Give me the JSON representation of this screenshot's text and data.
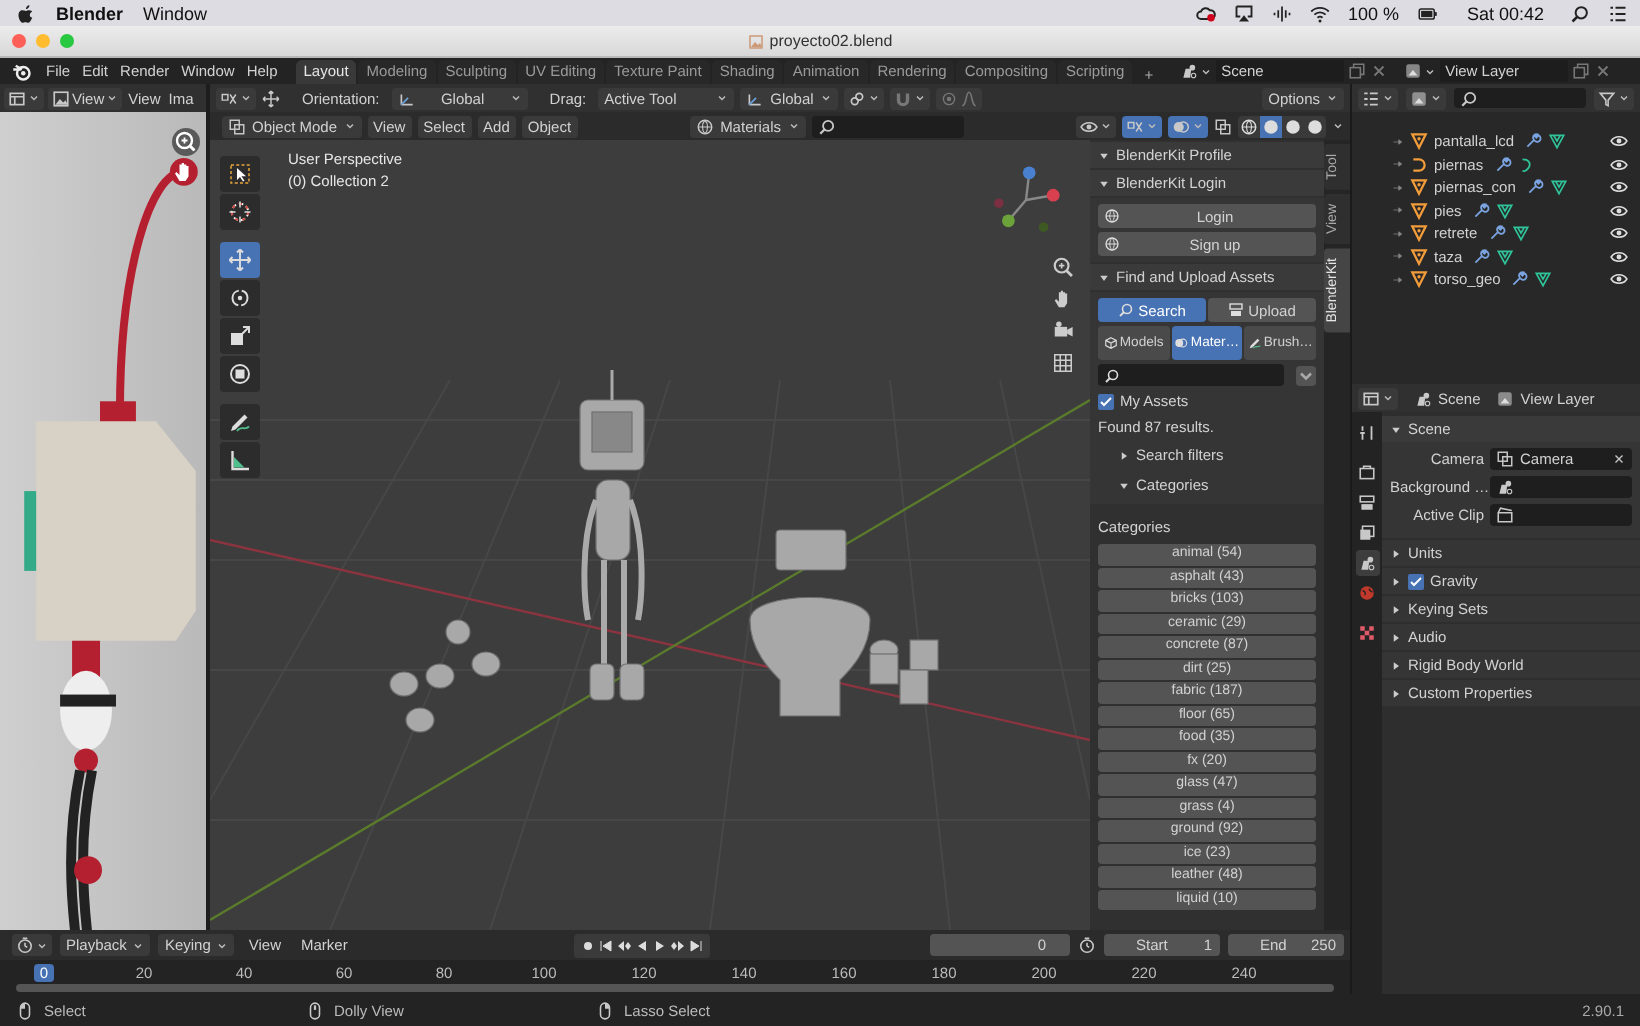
{
  "mac_menubar": {
    "app": "Blender",
    "menus": [
      "Window"
    ],
    "battery": "100 %",
    "clock": "Sat 00:42"
  },
  "window": {
    "title": "proyecto02.blend"
  },
  "topbar": {
    "menus": [
      "File",
      "Edit",
      "Render",
      "Window",
      "Help"
    ],
    "workspaces": [
      {
        "label": "Layout",
        "selected": true
      },
      {
        "label": "Modeling",
        "selected": false
      },
      {
        "label": "Sculpting",
        "selected": false
      },
      {
        "label": "UV Editing",
        "selected": false
      },
      {
        "label": "Texture Paint",
        "selected": false
      },
      {
        "label": "Shading",
        "selected": false
      },
      {
        "label": "Animation",
        "selected": false
      },
      {
        "label": "Rendering",
        "selected": false
      },
      {
        "label": "Compositing",
        "selected": false
      },
      {
        "label": "Scripting",
        "selected": false
      }
    ],
    "add_workspace": "+",
    "scene": "Scene",
    "view_layer": "View Layer"
  },
  "image_editor": {
    "view_dropdown": "View",
    "menus": [
      "View",
      "Ima"
    ]
  },
  "tool_header": {
    "orientation_label": "Orientation:",
    "orientation": "Global",
    "drag_label": "Drag:",
    "drag": "Active Tool",
    "pivot_orientation": "Global",
    "options": "Options"
  },
  "viewport_header": {
    "mode": "Object Mode",
    "menus": [
      "View",
      "Select",
      "Add",
      "Object"
    ],
    "filter": "Materials",
    "shading": [
      {
        "selected": false
      },
      {
        "selected": true
      },
      {
        "selected": false
      },
      {
        "selected": false
      }
    ]
  },
  "viewport": {
    "perspective": "User Perspective",
    "collection": "(0) Collection 2",
    "tools": [
      {
        "kind": "select",
        "selected": false
      },
      {
        "kind": "cursor",
        "selected": false
      },
      {
        "kind": "move",
        "selected": true
      },
      {
        "kind": "rotate",
        "selected": false
      },
      {
        "kind": "scale",
        "selected": false
      },
      {
        "kind": "transform",
        "selected": false
      },
      {
        "kind": "annotate",
        "selected": false
      },
      {
        "kind": "measure",
        "selected": false
      }
    ]
  },
  "sidebar": {
    "tabs": [
      {
        "label": "Tool",
        "selected": false
      },
      {
        "label": "View",
        "selected": false
      },
      {
        "label": "BlenderKit",
        "selected": true
      }
    ],
    "profile_panel": {
      "title": "BlenderKit Profile",
      "expanded": true
    },
    "login_panel": {
      "title": "BlenderKit Login",
      "expanded": true,
      "buttons": [
        "Login",
        "Sign up"
      ]
    },
    "assets_panel": {
      "title": "Find and Upload Assets",
      "expanded": true,
      "modes": [
        {
          "label": "Search",
          "selected": true
        },
        {
          "label": "Upload",
          "selected": false
        }
      ],
      "asset_types": [
        {
          "label": "Models",
          "selected": false
        },
        {
          "label": "Mater…",
          "selected": true
        },
        {
          "label": "Brush…",
          "selected": false
        }
      ],
      "my_assets": {
        "label": "My Assets",
        "checked": true
      },
      "results": "Found 87 results.",
      "subpanels": [
        {
          "title": "Search filters",
          "expanded": false
        },
        {
          "title": "Categories",
          "expanded": true
        }
      ],
      "categories_label": "Categories",
      "categories": [
        "animal (54)",
        "asphalt (43)",
        "bricks (103)",
        "ceramic (29)",
        "concrete (87)",
        "dirt (25)",
        "fabric (187)",
        "floor (65)",
        "food (35)",
        "fx (20)",
        "glass (47)",
        "grass (4)",
        "ground (92)",
        "ice (23)",
        "leather (48)",
        "liquid (10)"
      ]
    }
  },
  "outliner": {
    "rows": [
      {
        "name": "pantalla_lcd",
        "kind": "mesh"
      },
      {
        "name": "piernas",
        "kind": "curve"
      },
      {
        "name": "piernas_con",
        "kind": "mesh"
      },
      {
        "name": "pies",
        "kind": "mesh"
      },
      {
        "name": "retrete",
        "kind": "mesh"
      },
      {
        "name": "taza",
        "kind": "mesh"
      },
      {
        "name": "torso_geo",
        "kind": "mesh"
      }
    ]
  },
  "properties": {
    "context": "Scene",
    "view_layer": "View Layer",
    "tabs": [
      {
        "kind": "tool",
        "selected": false
      },
      {
        "kind": "render",
        "selected": false
      },
      {
        "kind": "output",
        "selected": false
      },
      {
        "kind": "view_layer",
        "selected": false
      },
      {
        "kind": "scene",
        "selected": true
      },
      {
        "kind": "world",
        "selected": false
      },
      {
        "kind": "texture",
        "selected": false
      }
    ],
    "panel": {
      "title": "Scene",
      "expanded": true,
      "fields": [
        {
          "label": "Camera",
          "value": "Camera"
        },
        {
          "label": "Background …"
        },
        {
          "label": "Active Clip"
        }
      ]
    },
    "subpanels": [
      {
        "title": "Units",
        "expanded": false
      },
      {
        "title": "Gravity",
        "expanded": false,
        "checked": true
      },
      {
        "title": "Keying Sets",
        "expanded": false
      },
      {
        "title": "Audio",
        "expanded": false
      },
      {
        "title": "Rigid Body World",
        "expanded": false
      },
      {
        "title": "Custom Properties",
        "expanded": false
      }
    ]
  },
  "timeline": {
    "menus": [
      {
        "label": "Playback",
        "dropdown": true
      },
      {
        "label": "Keying",
        "dropdown": true
      },
      {
        "label": "View",
        "dropdown": false
      },
      {
        "label": "Marker",
        "dropdown": false
      }
    ],
    "current_frame": "0",
    "start_label": "Start",
    "start": "1",
    "end_label": "End",
    "end": "250",
    "ruler": [
      {
        "label": "0",
        "selected": true
      },
      {
        "label": "20",
        "selected": false
      },
      {
        "label": "40",
        "selected": false
      },
      {
        "label": "60",
        "selected": false
      },
      {
        "label": "80",
        "selected": false
      },
      {
        "label": "100",
        "selected": false
      },
      {
        "label": "120",
        "selected": false
      },
      {
        "label": "140",
        "selected": false
      },
      {
        "label": "160",
        "selected": false
      },
      {
        "label": "180",
        "selected": false
      },
      {
        "label": "200",
        "selected": false
      },
      {
        "label": "220",
        "selected": false
      },
      {
        "label": "240",
        "selected": false
      }
    ]
  },
  "status_bar": {
    "items": [
      {
        "kind": "left",
        "label": "Select"
      },
      {
        "kind": "middle",
        "label": "Dolly View"
      },
      {
        "kind": "right",
        "label": "Lasso Select"
      }
    ],
    "version": "2.90.1"
  }
}
